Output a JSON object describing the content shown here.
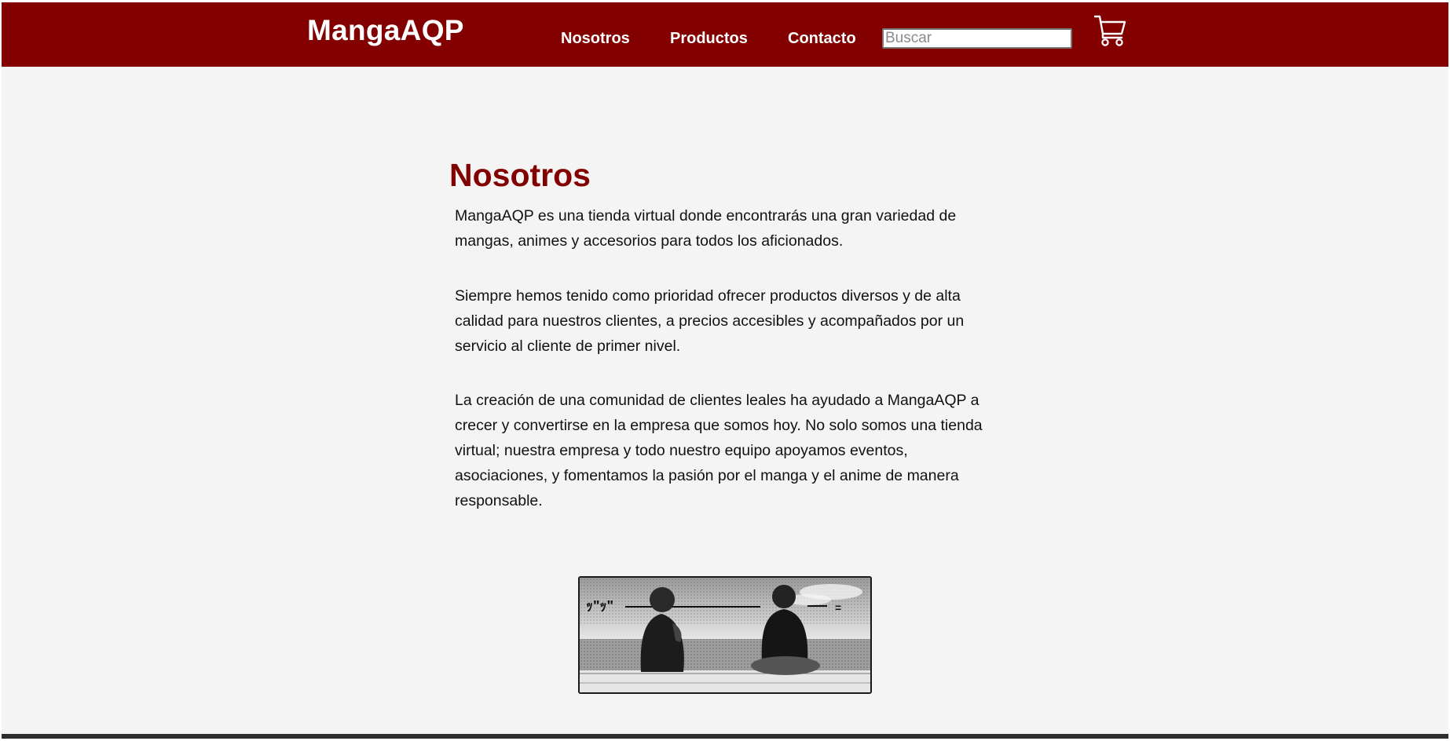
{
  "header": {
    "brand": "MangaAQP",
    "nav": [
      {
        "label": "Nosotros"
      },
      {
        "label": "Productos"
      },
      {
        "label": "Contacto"
      }
    ],
    "search_placeholder": "Buscar",
    "search_value": "",
    "cart_icon": "shopping-cart-icon"
  },
  "main": {
    "title": "Nosotros",
    "paragraphs": [
      "MangaAQP es una tienda virtual donde encontrarás una gran variedad de mangas, animes y accesorios para todos los aficionados.",
      "Siempre hemos tenido como prioridad ofrecer productos diversos y de alta calidad para nuestros clientes, a precios accesibles y acompañados por un servicio al cliente de primer nivel.",
      "La creación de una comunidad de clientes leales ha ayudado a MangaAQP a crecer y convertirse en la empresa que somos hoy. No solo somos una tienda virtual; nuestra empresa y todo nuestro equipo apoyamos eventos, asociaciones, y fomentamos la pasión por el manga y el anime de manera responsable."
    ],
    "image_icon": "manga-panel-illustration"
  },
  "colors": {
    "brand": "#830000",
    "page_background": "#f4f4f4",
    "text": "#111111"
  }
}
